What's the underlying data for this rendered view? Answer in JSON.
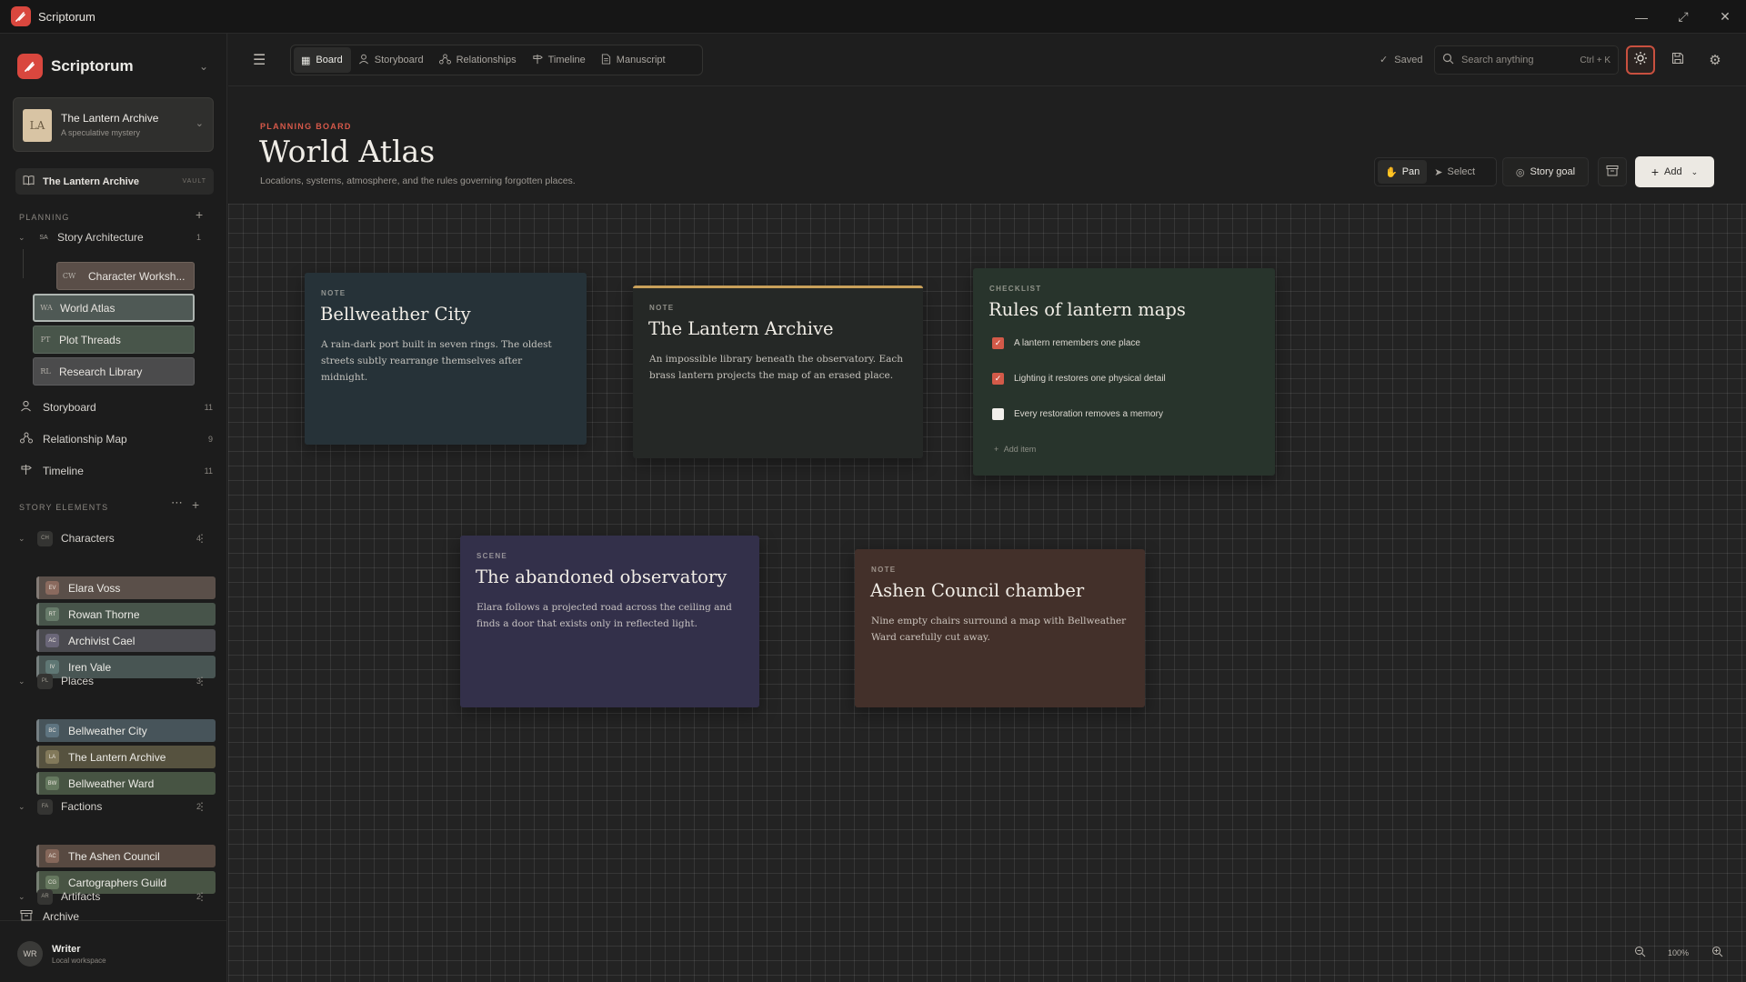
{
  "window": {
    "title": "Scriptorum"
  },
  "sidebar": {
    "brand": "Scriptorum",
    "project": {
      "initials": "LA",
      "name": "The Lantern Archive",
      "tagline": "A speculative mystery"
    },
    "vault": {
      "label": "The Lantern Archive",
      "tag": "VAULT"
    },
    "planning": {
      "header": "PLANNING",
      "folder": {
        "abbr": "SA",
        "label": "Story Architecture",
        "count": "1"
      },
      "docs": [
        {
          "abbr": "CW",
          "label": "Character Worksh..."
        },
        {
          "abbr": "WA",
          "label": "World Atlas"
        },
        {
          "abbr": "PT",
          "label": "Plot Threads"
        },
        {
          "abbr": "RL",
          "label": "Research Library"
        }
      ]
    },
    "nav": [
      {
        "label": "Storyboard",
        "count": "11"
      },
      {
        "label": "Relationship Map",
        "count": "9"
      },
      {
        "label": "Timeline",
        "count": "11"
      }
    ],
    "story_elements": {
      "header": "STORY ELEMENTS",
      "groups": [
        {
          "abbr": "CH",
          "label": "Characters",
          "count": "4",
          "items": [
            {
              "abbr": "EV",
              "label": "Elara Voss"
            },
            {
              "abbr": "RT",
              "label": "Rowan Thorne"
            },
            {
              "abbr": "AC",
              "label": "Archivist Cael"
            },
            {
              "abbr": "IV",
              "label": "Iren Vale"
            }
          ]
        },
        {
          "abbr": "PL",
          "label": "Places",
          "count": "3",
          "items": [
            {
              "abbr": "BC",
              "label": "Bellweather City"
            },
            {
              "abbr": "LA",
              "label": "The Lantern Archive"
            },
            {
              "abbr": "BW",
              "label": "Bellweather Ward"
            }
          ]
        },
        {
          "abbr": "FA",
          "label": "Factions",
          "count": "2",
          "items": [
            {
              "abbr": "AC",
              "label": "The Ashen Council"
            },
            {
              "abbr": "CG",
              "label": "Cartographers Guild"
            }
          ]
        },
        {
          "abbr": "AR",
          "label": "Artifacts",
          "count": "2",
          "items": []
        }
      ]
    },
    "archive": "Archive",
    "user": {
      "initials": "WR",
      "name": "Writer",
      "sub": "Local workspace"
    }
  },
  "toolbar": {
    "tabs": [
      {
        "label": "Board",
        "icon": "board-icon"
      },
      {
        "label": "Storyboard",
        "icon": "person-icon"
      },
      {
        "label": "Relationships",
        "icon": "network-icon"
      },
      {
        "label": "Timeline",
        "icon": "signpost-icon"
      },
      {
        "label": "Manuscript",
        "icon": "document-icon"
      }
    ],
    "saved": "Saved",
    "search_placeholder": "Search anything",
    "search_shortcut": "Ctrl + K"
  },
  "header": {
    "kicker": "PLANNING BOARD",
    "title": "World Atlas",
    "subtitle": "Locations, systems, atmosphere, and the rules governing forgotten places.",
    "modes": [
      "Pan",
      "Select"
    ],
    "goal": "Story goal",
    "add": "Add"
  },
  "cards": {
    "bellweather": {
      "type": "NOTE",
      "title": "Bellweather City",
      "body": "A rain-dark port built in seven rings. The oldest streets subtly rearrange themselves after midnight."
    },
    "lantern": {
      "type": "NOTE",
      "title": "The Lantern Archive",
      "body": "An impossible library beneath the observatory. Each brass lantern projects the map of an erased place."
    },
    "checklist": {
      "type": "CHECKLIST",
      "title": "Rules of lantern maps",
      "items": [
        {
          "label": "A lantern remembers one place",
          "checked": true
        },
        {
          "label": "Lighting it restores one physical detail",
          "checked": true
        },
        {
          "label": "Every restoration removes a memory",
          "checked": false
        }
      ],
      "add_item": "Add item"
    },
    "observatory": {
      "type": "SCENE",
      "title": "The abandoned observatory",
      "body": "Elara follows a projected road across the ceiling and finds a door that exists only in reflected light."
    },
    "ashen": {
      "type": "NOTE",
      "title": "Ashen Council chamber",
      "body": "Nine empty chairs surround a map with Bellweather Ward carefully cut away."
    }
  },
  "zoom": {
    "level": "100%"
  },
  "colors": {
    "accent": "#d9473e",
    "canvas": "#232323"
  }
}
